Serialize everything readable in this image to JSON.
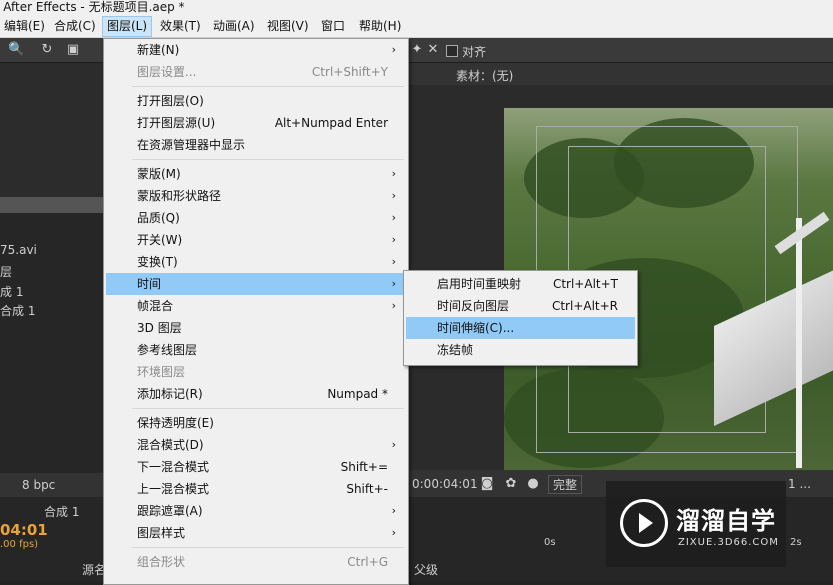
{
  "window": {
    "title": "e After Effects - 无标题项目.aep *"
  },
  "menubar": {
    "items": [
      "编辑(E)",
      "合成(C)",
      "图层(L)",
      "效果(T)",
      "动画(A)",
      "视图(V)",
      "窗口",
      "帮助(H)"
    ]
  },
  "toolbar": {
    "align_label": "对齐"
  },
  "panels": {
    "source_tab": "素材：(无)",
    "project_file": "75.avi",
    "project_row1": "层",
    "project_row2": "成 1",
    "project_row3": "合成 1",
    "bpc": "8 bpc",
    "comp_tab": "合成 1",
    "timecode": "04:01",
    "fps": ".00 fps)",
    "viewer_time": "0:00:04:01",
    "quality": "完整",
    "view_count": "1 ...",
    "time_ruler_0": "0s",
    "time_ruler_2": "2s",
    "col_source": "源名",
    "col_parent": "父级"
  },
  "layer_menu": {
    "items": [
      {
        "label": "新建(N)",
        "shortcut": "",
        "submenu": true,
        "disabled": false
      },
      {
        "label": "图层设置...",
        "shortcut": "Ctrl+Shift+Y",
        "submenu": false,
        "disabled": true
      },
      {
        "label": "打开图层(O)",
        "shortcut": "",
        "submenu": false,
        "disabled": false
      },
      {
        "label": "打开图层源(U)",
        "shortcut": "Alt+Numpad Enter",
        "submenu": false,
        "disabled": false
      },
      {
        "label": "在资源管理器中显示",
        "shortcut": "",
        "submenu": false,
        "disabled": false
      },
      {
        "label": "蒙版(M)",
        "shortcut": "",
        "submenu": true,
        "disabled": false
      },
      {
        "label": "蒙版和形状路径",
        "shortcut": "",
        "submenu": true,
        "disabled": false
      },
      {
        "label": "品质(Q)",
        "shortcut": "",
        "submenu": true,
        "disabled": false
      },
      {
        "label": "开关(W)",
        "shortcut": "",
        "submenu": true,
        "disabled": false
      },
      {
        "label": "变换(T)",
        "shortcut": "",
        "submenu": true,
        "disabled": false
      },
      {
        "label": "时间",
        "shortcut": "",
        "submenu": true,
        "disabled": false
      },
      {
        "label": "帧混合",
        "shortcut": "",
        "submenu": true,
        "disabled": false
      },
      {
        "label": "3D 图层",
        "shortcut": "",
        "submenu": false,
        "disabled": false
      },
      {
        "label": "参考线图层",
        "shortcut": "",
        "submenu": false,
        "disabled": false
      },
      {
        "label": "环境图层",
        "shortcut": "",
        "submenu": false,
        "disabled": true
      },
      {
        "label": "添加标记(R)",
        "shortcut": "Numpad *",
        "submenu": false,
        "disabled": false
      },
      {
        "label": "保持透明度(E)",
        "shortcut": "",
        "submenu": false,
        "disabled": false
      },
      {
        "label": "混合模式(D)",
        "shortcut": "",
        "submenu": true,
        "disabled": false
      },
      {
        "label": "下一混合模式",
        "shortcut": "Shift+=",
        "submenu": false,
        "disabled": false
      },
      {
        "label": "上一混合模式",
        "shortcut": "Shift+-",
        "submenu": false,
        "disabled": false
      },
      {
        "label": "跟踪遮罩(A)",
        "shortcut": "",
        "submenu": true,
        "disabled": false
      },
      {
        "label": "图层样式",
        "shortcut": "",
        "submenu": true,
        "disabled": false
      },
      {
        "label": "组合形状",
        "shortcut": "Ctrl+G",
        "submenu": false,
        "disabled": true
      }
    ]
  },
  "time_submenu": {
    "items": [
      {
        "label": "启用时间重映射",
        "shortcut": "Ctrl+Alt+T"
      },
      {
        "label": "时间反向图层",
        "shortcut": "Ctrl+Alt+R"
      },
      {
        "label": "时间伸缩(C)...",
        "shortcut": ""
      },
      {
        "label": "冻结帧",
        "shortcut": ""
      }
    ]
  },
  "watermark": {
    "brand": "溜溜自学",
    "url": "ZIXUE.3D66.COM"
  },
  "colors": {
    "highlight": "#91c9f7",
    "menu_bg": "#f0f0f0",
    "timecode": "#e8a33a"
  }
}
